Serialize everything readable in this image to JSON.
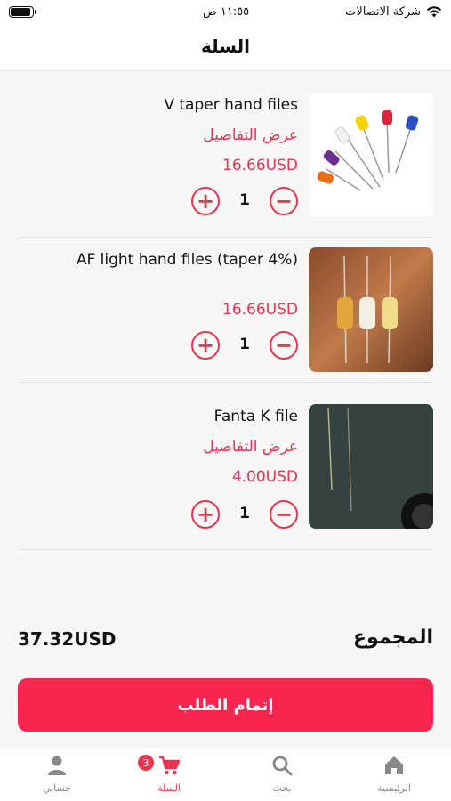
{
  "status_bar": {
    "carrier": "شركة الاتصالات",
    "time": "١١:٥٥ ص"
  },
  "header": {
    "title": "السلة"
  },
  "cart": {
    "items": [
      {
        "name": "V taper hand files",
        "details_link": "عرض التفاصيل",
        "price": "16.66USD",
        "quantity": "1"
      },
      {
        "name": "AF light hand files (taper 4%)",
        "details_link": "",
        "price": "16.66USD",
        "quantity": "1"
      },
      {
        "name": "Fanta K file",
        "details_link": "عرض التفاصيل",
        "price": "4.00USD",
        "quantity": "1"
      }
    ],
    "plus_symbol": "+",
    "minus_symbol": "−"
  },
  "summary": {
    "total_label": "المجموع",
    "total_amount": "37.32USD"
  },
  "checkout": {
    "label": "إتمام الطلب"
  },
  "tabbar": {
    "tabs": [
      {
        "label": "الرئيسية",
        "icon": "home-icon"
      },
      {
        "label": "بحث",
        "icon": "search-icon"
      },
      {
        "label": "السلة",
        "icon": "cart-icon",
        "badge": "3"
      },
      {
        "label": "حسابي",
        "icon": "user-icon"
      }
    ]
  },
  "colors": {
    "accent": "#e8344e",
    "button": "#f8254f"
  }
}
